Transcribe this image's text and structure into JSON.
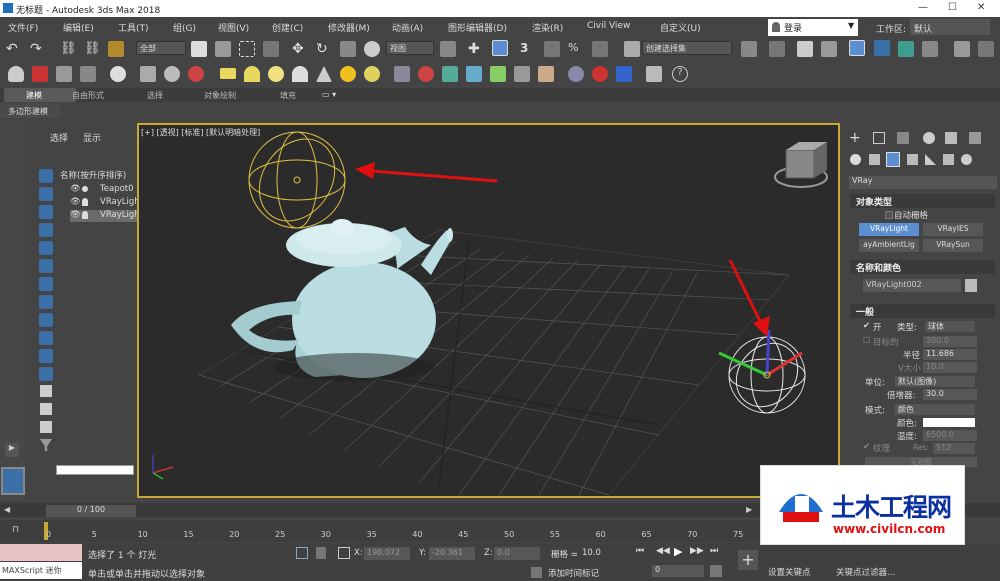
{
  "window": {
    "title": "无标题     - Autodesk 3ds Max 2018"
  },
  "menu": [
    "文件(F)",
    "编辑(E)",
    "工具(T)",
    "组(G)",
    "视图(V)",
    "创建(C)",
    "修改器(M)",
    "动画(A)",
    "图形编辑器(D)",
    "渲染(R)",
    "Civil View",
    "自定义(U)"
  ],
  "login": "登录",
  "workspace": {
    "label": "工作区:",
    "value": "默认"
  },
  "toolbar": {
    "selection_filter": "全部",
    "ref_coord": "视图",
    "named_selection": "创建选择集"
  },
  "ribbon": {
    "tabs": [
      "建模",
      "自由形式",
      "选择",
      "对象绘制",
      "填充"
    ],
    "subtitle": "多边形建模"
  },
  "scene_explorer": {
    "tab_select": "选择",
    "tab_display": "显示",
    "header": "名称(按升序排序)",
    "rows": [
      "Teapot0",
      "VRayLigh",
      "VRayLigh"
    ]
  },
  "viewport": {
    "label": "[+] [透视] [标准] [默认明暗处理]"
  },
  "command_panel": {
    "category": "VRay",
    "object_type": {
      "title": "对象类型",
      "autogrid": "自动栅格",
      "buttons": [
        "VRayLight",
        "VRayIES",
        "ayAmbientLig",
        "VRaySun"
      ]
    },
    "name_color": {
      "title": "名称和颜色",
      "name": "VRayLight002"
    },
    "general": {
      "title": "一般",
      "on": "开",
      "type_label": "类型:",
      "type_value": "球体",
      "target_label": "目标的",
      "target_value": "200.0",
      "radius_label": "半径",
      "radius_value": "11.686",
      "vsize_label": "V大小",
      "vsize_value": "10.0",
      "units_label": "单位:",
      "units_value": "默认(图像)",
      "mult_label": "倍增器:",
      "mult_value": "30.0",
      "mode_label": "模式:",
      "mode_value": "颜色",
      "color_label": "颜色:",
      "temp_label": "温度:",
      "temp_value": "6500.0",
      "texture_label": "纹理",
      "res_label": "Res:",
      "res_value": "512",
      "nomap": "无贴图"
    }
  },
  "timeline": {
    "frame": "0 / 100",
    "ticks": [
      "0",
      "5",
      "10",
      "15",
      "20",
      "25",
      "30",
      "35",
      "40",
      "45",
      "50",
      "55",
      "60",
      "65",
      "70",
      "75"
    ]
  },
  "status": {
    "script": "MAXScript 迷你",
    "selected": "选择了 1 个 灯光",
    "prompt": "单击或单击并拖动以选择对象",
    "x_label": "X:",
    "x": "190.072",
    "y_label": "Y:",
    "y": "-20.361",
    "z_label": "Z:",
    "z": "0.0",
    "grid_label": "栅格 =",
    "grid": "10.0",
    "add_tag": "添加时间标记",
    "set_key": "设置关键点",
    "key_filter": "关键点过滤器...",
    "frame": "0"
  },
  "watermark": {
    "brand": "土木工程网",
    "url": "www.civilcn.com"
  },
  "colors": {
    "accent": "#5b8fd1",
    "viewport_border": "#c8a833",
    "arrow": "#e01010",
    "teapot": "#b9dde0",
    "light": "#e0c040"
  }
}
